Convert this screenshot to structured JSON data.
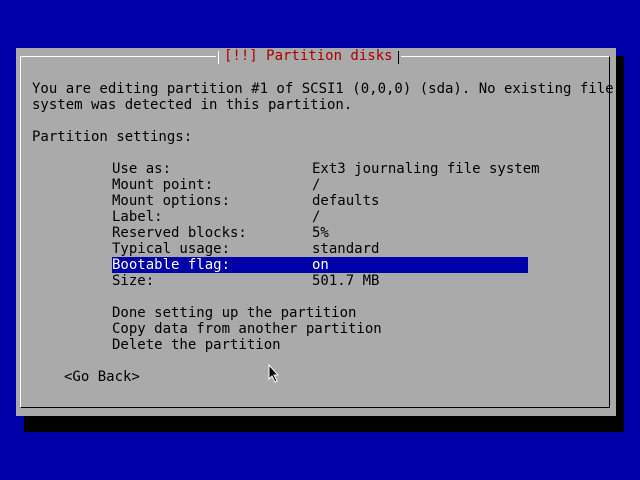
{
  "dialog": {
    "title": "[!!] Partition disks",
    "description_line1": "You are editing partition #1 of SCSI1 (0,0,0) (sda). No existing file",
    "description_line2": "system was detected in this partition.",
    "settings_heading": "Partition settings:"
  },
  "settings": [
    {
      "label": "Use as:",
      "value": "Ext3 journaling file system"
    },
    {
      "label": "Mount point:",
      "value": "/"
    },
    {
      "label": "Mount options:",
      "value": "defaults"
    },
    {
      "label": "Label:",
      "value": "/"
    },
    {
      "label": "Reserved blocks:",
      "value": "5%"
    },
    {
      "label": "Typical usage:",
      "value": "standard"
    },
    {
      "label": "Bootable flag:",
      "value": "on"
    },
    {
      "label": "Size:",
      "value": "501.7 MB"
    }
  ],
  "actions": {
    "done": "Done setting up the partition",
    "copy": "Copy data from another partition",
    "delete": "Delete the partition"
  },
  "buttons": {
    "go_back": "<Go Back>"
  },
  "colors": {
    "background": "#0000a8",
    "dialog": "#aaaaaa",
    "title": "#a80000",
    "selection": "#0000a8"
  },
  "icons": {
    "cursor": "mouse-pointer-icon"
  }
}
